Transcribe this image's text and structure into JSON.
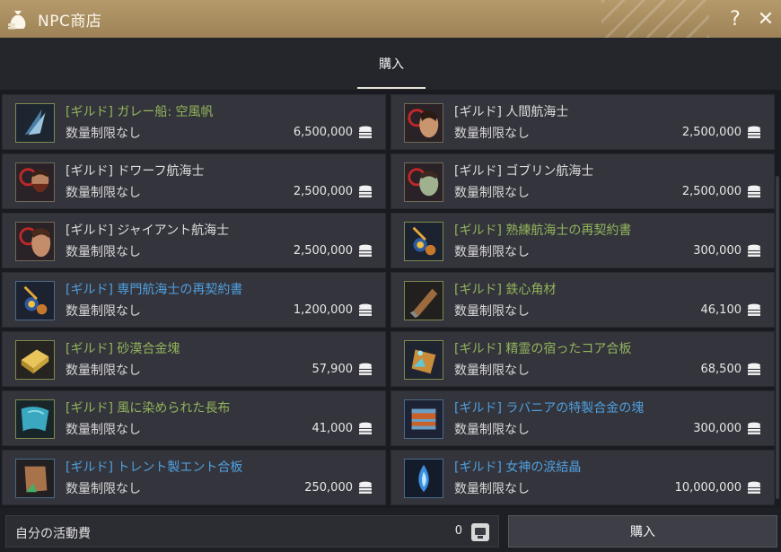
{
  "window": {
    "title": "NPC商店",
    "title_icon": "money-bag-icon",
    "help_label": "?",
    "close_label": "✕"
  },
  "tabs": [
    {
      "label": "購入",
      "active": true
    }
  ],
  "items": [
    {
      "name": "[ギルド] ガレー船: 空風帆",
      "limit": "数量制限なし",
      "price": "6,500,000",
      "name_color": "green",
      "icon": "sail-icon"
    },
    {
      "name": "[ギルド] 人間航海士",
      "limit": "数量制限なし",
      "price": "2,500,000",
      "name_color": "white",
      "icon": "human-navigator-icon"
    },
    {
      "name": "[ギルド] ドワーフ航海士",
      "limit": "数量制限なし",
      "price": "2,500,000",
      "name_color": "white",
      "icon": "dwarf-navigator-icon"
    },
    {
      "name": "[ギルド] ゴブリン航海士",
      "limit": "数量制限なし",
      "price": "2,500,000",
      "name_color": "white",
      "icon": "goblin-navigator-icon"
    },
    {
      "name": "[ギルド] ジャイアント航海士",
      "limit": "数量制限なし",
      "price": "2,500,000",
      "name_color": "white",
      "icon": "giant-navigator-icon"
    },
    {
      "name": "[ギルド] 熟練航海士の再契約書",
      "limit": "数量制限なし",
      "price": "300,000",
      "name_color": "green",
      "icon": "scroll-contract-icon"
    },
    {
      "name": "[ギルド] 専門航海士の再契約書",
      "limit": "数量制限なし",
      "price": "1,200,000",
      "name_color": "blue",
      "icon": "scroll-contract-icon"
    },
    {
      "name": "[ギルド] 鉄心角材",
      "limit": "数量制限なし",
      "price": "46,100",
      "name_color": "green",
      "icon": "iron-timber-icon"
    },
    {
      "name": "[ギルド] 砂漠合金塊",
      "limit": "数量制限なし",
      "price": "57,900",
      "name_color": "green",
      "icon": "alloy-ingot-icon"
    },
    {
      "name": "[ギルド] 精霊の宿ったコア合板",
      "limit": "数量制限なし",
      "price": "68,500",
      "name_color": "green",
      "icon": "core-plywood-icon"
    },
    {
      "name": "[ギルド] 風に染められた長布",
      "limit": "数量制限なし",
      "price": "41,000",
      "name_color": "green",
      "icon": "cloth-icon"
    },
    {
      "name": "[ギルド] ラバニアの特製合金の塊",
      "limit": "数量制限なし",
      "price": "300,000",
      "name_color": "blue",
      "icon": "special-alloy-icon"
    },
    {
      "name": "[ギルド] トレント製エント合板",
      "limit": "数量制限なし",
      "price": "250,000",
      "name_color": "blue",
      "icon": "ent-plywood-icon"
    },
    {
      "name": "[ギルド] 女神の涙結晶",
      "limit": "数量制限なし",
      "price": "10,000,000",
      "name_color": "blue",
      "icon": "tear-crystal-icon"
    }
  ],
  "currency_icon": "coin-stack-icon",
  "footer": {
    "funds_label": "自分の活動費",
    "funds_value": "0",
    "funds_icon": "activity-point-icon",
    "buy_label": "購入"
  }
}
